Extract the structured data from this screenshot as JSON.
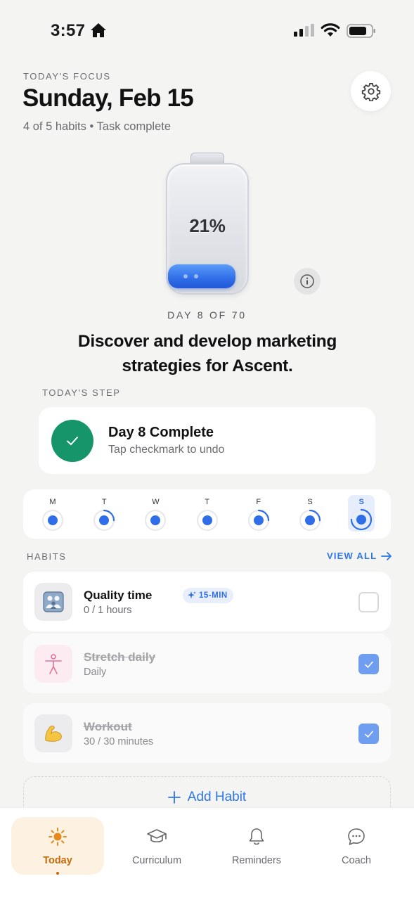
{
  "status_bar": {
    "time": "3:57"
  },
  "header": {
    "focus_label": "TODAY'S FOCUS",
    "date": "Sunday, Feb 15",
    "summary": "4 of 5 habits • Task complete",
    "settings_icon": "gear-icon"
  },
  "progress": {
    "percent_label": "21%",
    "fill_fraction": 0.21,
    "day_label": "DAY 8 OF 70",
    "goal": "Discover and develop marketing strategies for Ascent."
  },
  "today_step": {
    "section_label": "TODAY'S STEP",
    "title": "Day 8 Complete",
    "subtitle": "Tap checkmark to undo"
  },
  "week": {
    "days": [
      {
        "letter": "M",
        "progress": 0.0
      },
      {
        "letter": "T",
        "progress": 0.25
      },
      {
        "letter": "W",
        "progress": 0.0
      },
      {
        "letter": "T",
        "progress": 0.0
      },
      {
        "letter": "F",
        "progress": 0.25
      },
      {
        "letter": "S",
        "progress": 0.25
      },
      {
        "letter": "S",
        "progress": 0.75,
        "today": true
      }
    ],
    "accent": "#2f6ee8"
  },
  "habits": {
    "section_label": "HABITS",
    "view_all": "VIEW ALL",
    "items": [
      {
        "name": "Quality time",
        "meta": "0 / 1 hours",
        "tag": "15-MIN",
        "done": false,
        "icon": "family-icon"
      },
      {
        "name": "Stretch daily",
        "meta": "Daily",
        "done": true,
        "icon": "stretch-figure-icon"
      },
      {
        "name": "Workout",
        "meta": "30 / 30 minutes",
        "done": true,
        "icon": "flexed-bicep-icon"
      }
    ],
    "add_label": "Add Habit"
  },
  "tabs": [
    {
      "label": "Today",
      "icon": "sun-icon",
      "active": true
    },
    {
      "label": "Curriculum",
      "icon": "graduation-cap-icon",
      "active": false
    },
    {
      "label": "Reminders",
      "icon": "bell-icon",
      "active": false
    },
    {
      "label": "Coach",
      "icon": "chat-bubble-icon",
      "active": false
    }
  ],
  "colors": {
    "accent_blue": "#2f76e6",
    "success_green": "#17956a",
    "active_tab": "#c66a0a"
  }
}
